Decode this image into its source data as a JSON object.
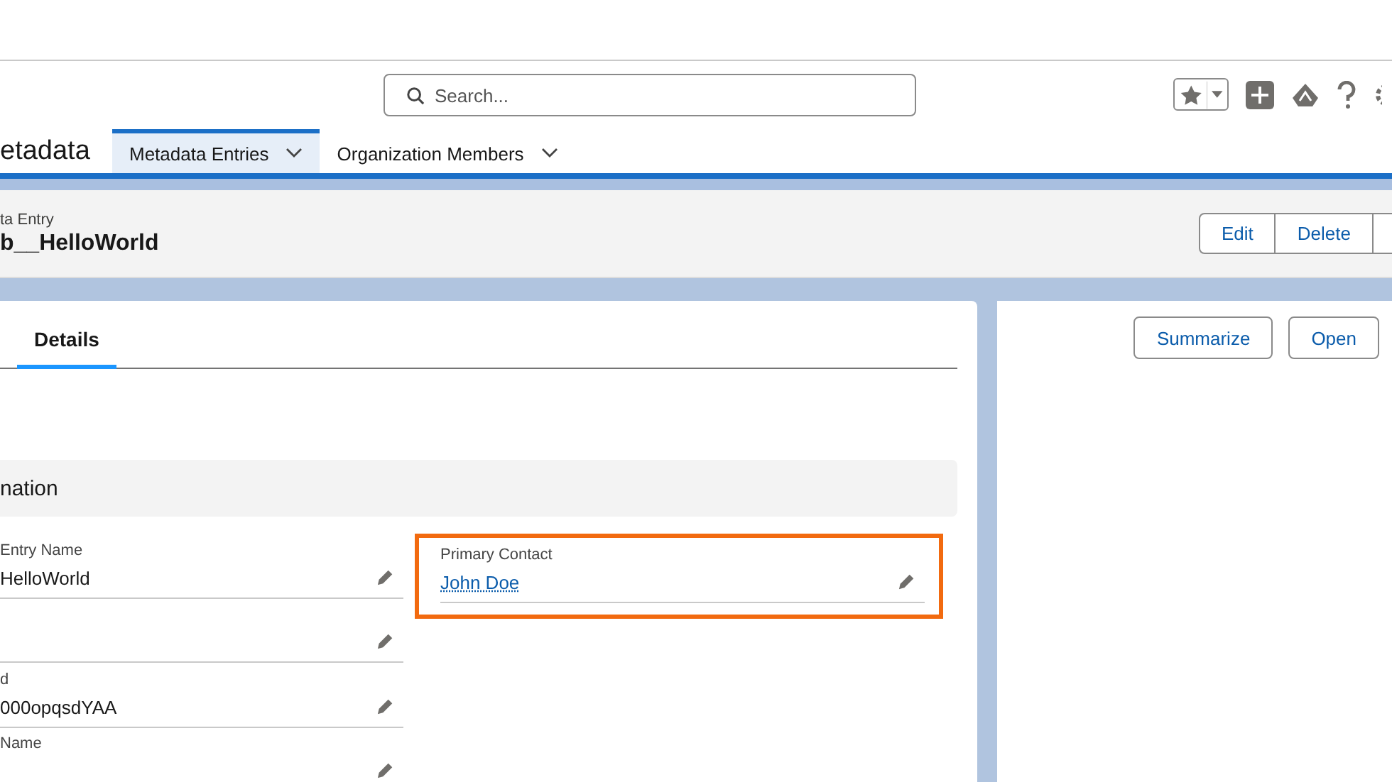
{
  "search": {
    "placeholder": "Search..."
  },
  "app_name": "etadata",
  "nav_tabs": [
    {
      "label": "Metadata Entries",
      "selected": true
    },
    {
      "label": "Organization Members",
      "selected": false
    }
  ],
  "record": {
    "type": "ta Entry",
    "title": "b__HelloWorld",
    "actions": [
      "Edit",
      "Delete"
    ]
  },
  "detail_tabs": [
    {
      "label": "Details",
      "selected": true
    }
  ],
  "section": {
    "title": "nation"
  },
  "left_fields": [
    {
      "kind": "field",
      "label": "Entry Name",
      "value": "HelloWorld"
    },
    {
      "kind": "blank"
    },
    {
      "kind": "field",
      "label": "d",
      "value": "000opqsdYAA"
    },
    {
      "kind": "field",
      "label": "Name"
    }
  ],
  "right_fields": [
    {
      "kind": "field",
      "label": "Primary Contact",
      "value": "John Doe",
      "link": true,
      "highlighted": true
    }
  ],
  "side_actions": [
    "Summarize",
    "Open"
  ]
}
